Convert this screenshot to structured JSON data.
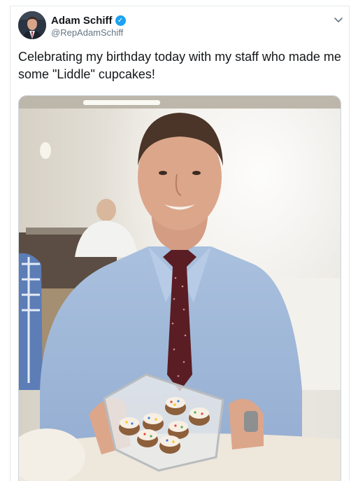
{
  "tweet": {
    "author": {
      "display_name": "Adam Schiff",
      "handle": "@RepAdamSchiff",
      "verified": true
    },
    "text": "Celebrating my birthday today with my staff who made me some \"Liddle\" cupcakes!",
    "menu_icon": "chevron-down-icon",
    "verified_icon": "verified-badge-icon"
  },
  "colors": {
    "text_primary": "#14171a",
    "text_secondary": "#657786",
    "verified": "#1da1f2",
    "border": "#e1e8ed"
  }
}
